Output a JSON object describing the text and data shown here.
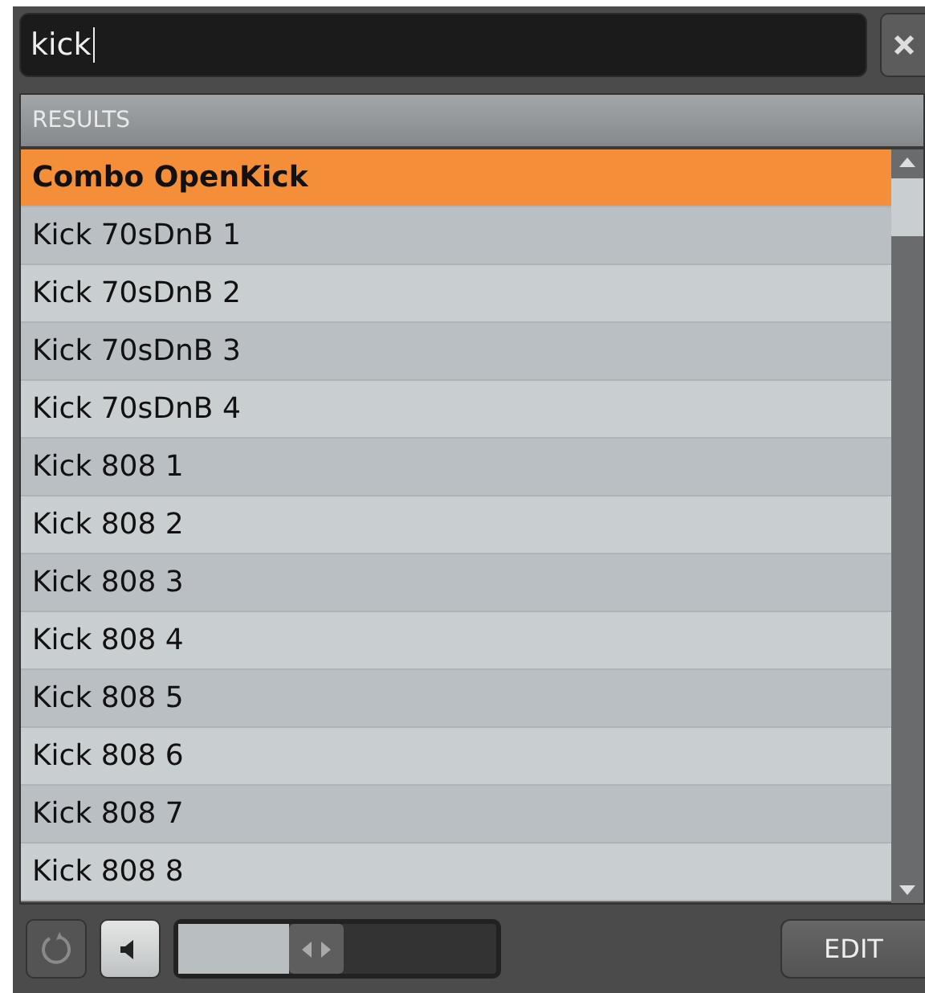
{
  "search": {
    "value": "kick"
  },
  "results": {
    "header": "RESULTS",
    "items": [
      {
        "label": "Combo OpenKick",
        "selected": true
      },
      {
        "label": "Kick 70sDnB 1",
        "selected": false
      },
      {
        "label": "Kick 70sDnB 2",
        "selected": false
      },
      {
        "label": "Kick 70sDnB 3",
        "selected": false
      },
      {
        "label": "Kick 70sDnB 4",
        "selected": false
      },
      {
        "label": "Kick 808 1",
        "selected": false
      },
      {
        "label": "Kick 808 2",
        "selected": false
      },
      {
        "label": "Kick 808 3",
        "selected": false
      },
      {
        "label": "Kick 808 4",
        "selected": false
      },
      {
        "label": "Kick 808 5",
        "selected": false
      },
      {
        "label": "Kick 808 6",
        "selected": false
      },
      {
        "label": "Kick 808 7",
        "selected": false
      },
      {
        "label": "Kick 808 8",
        "selected": false
      }
    ]
  },
  "toolbar": {
    "preview_on": true,
    "volume": {
      "level": 0.35
    },
    "edit_button": "EDIT"
  }
}
